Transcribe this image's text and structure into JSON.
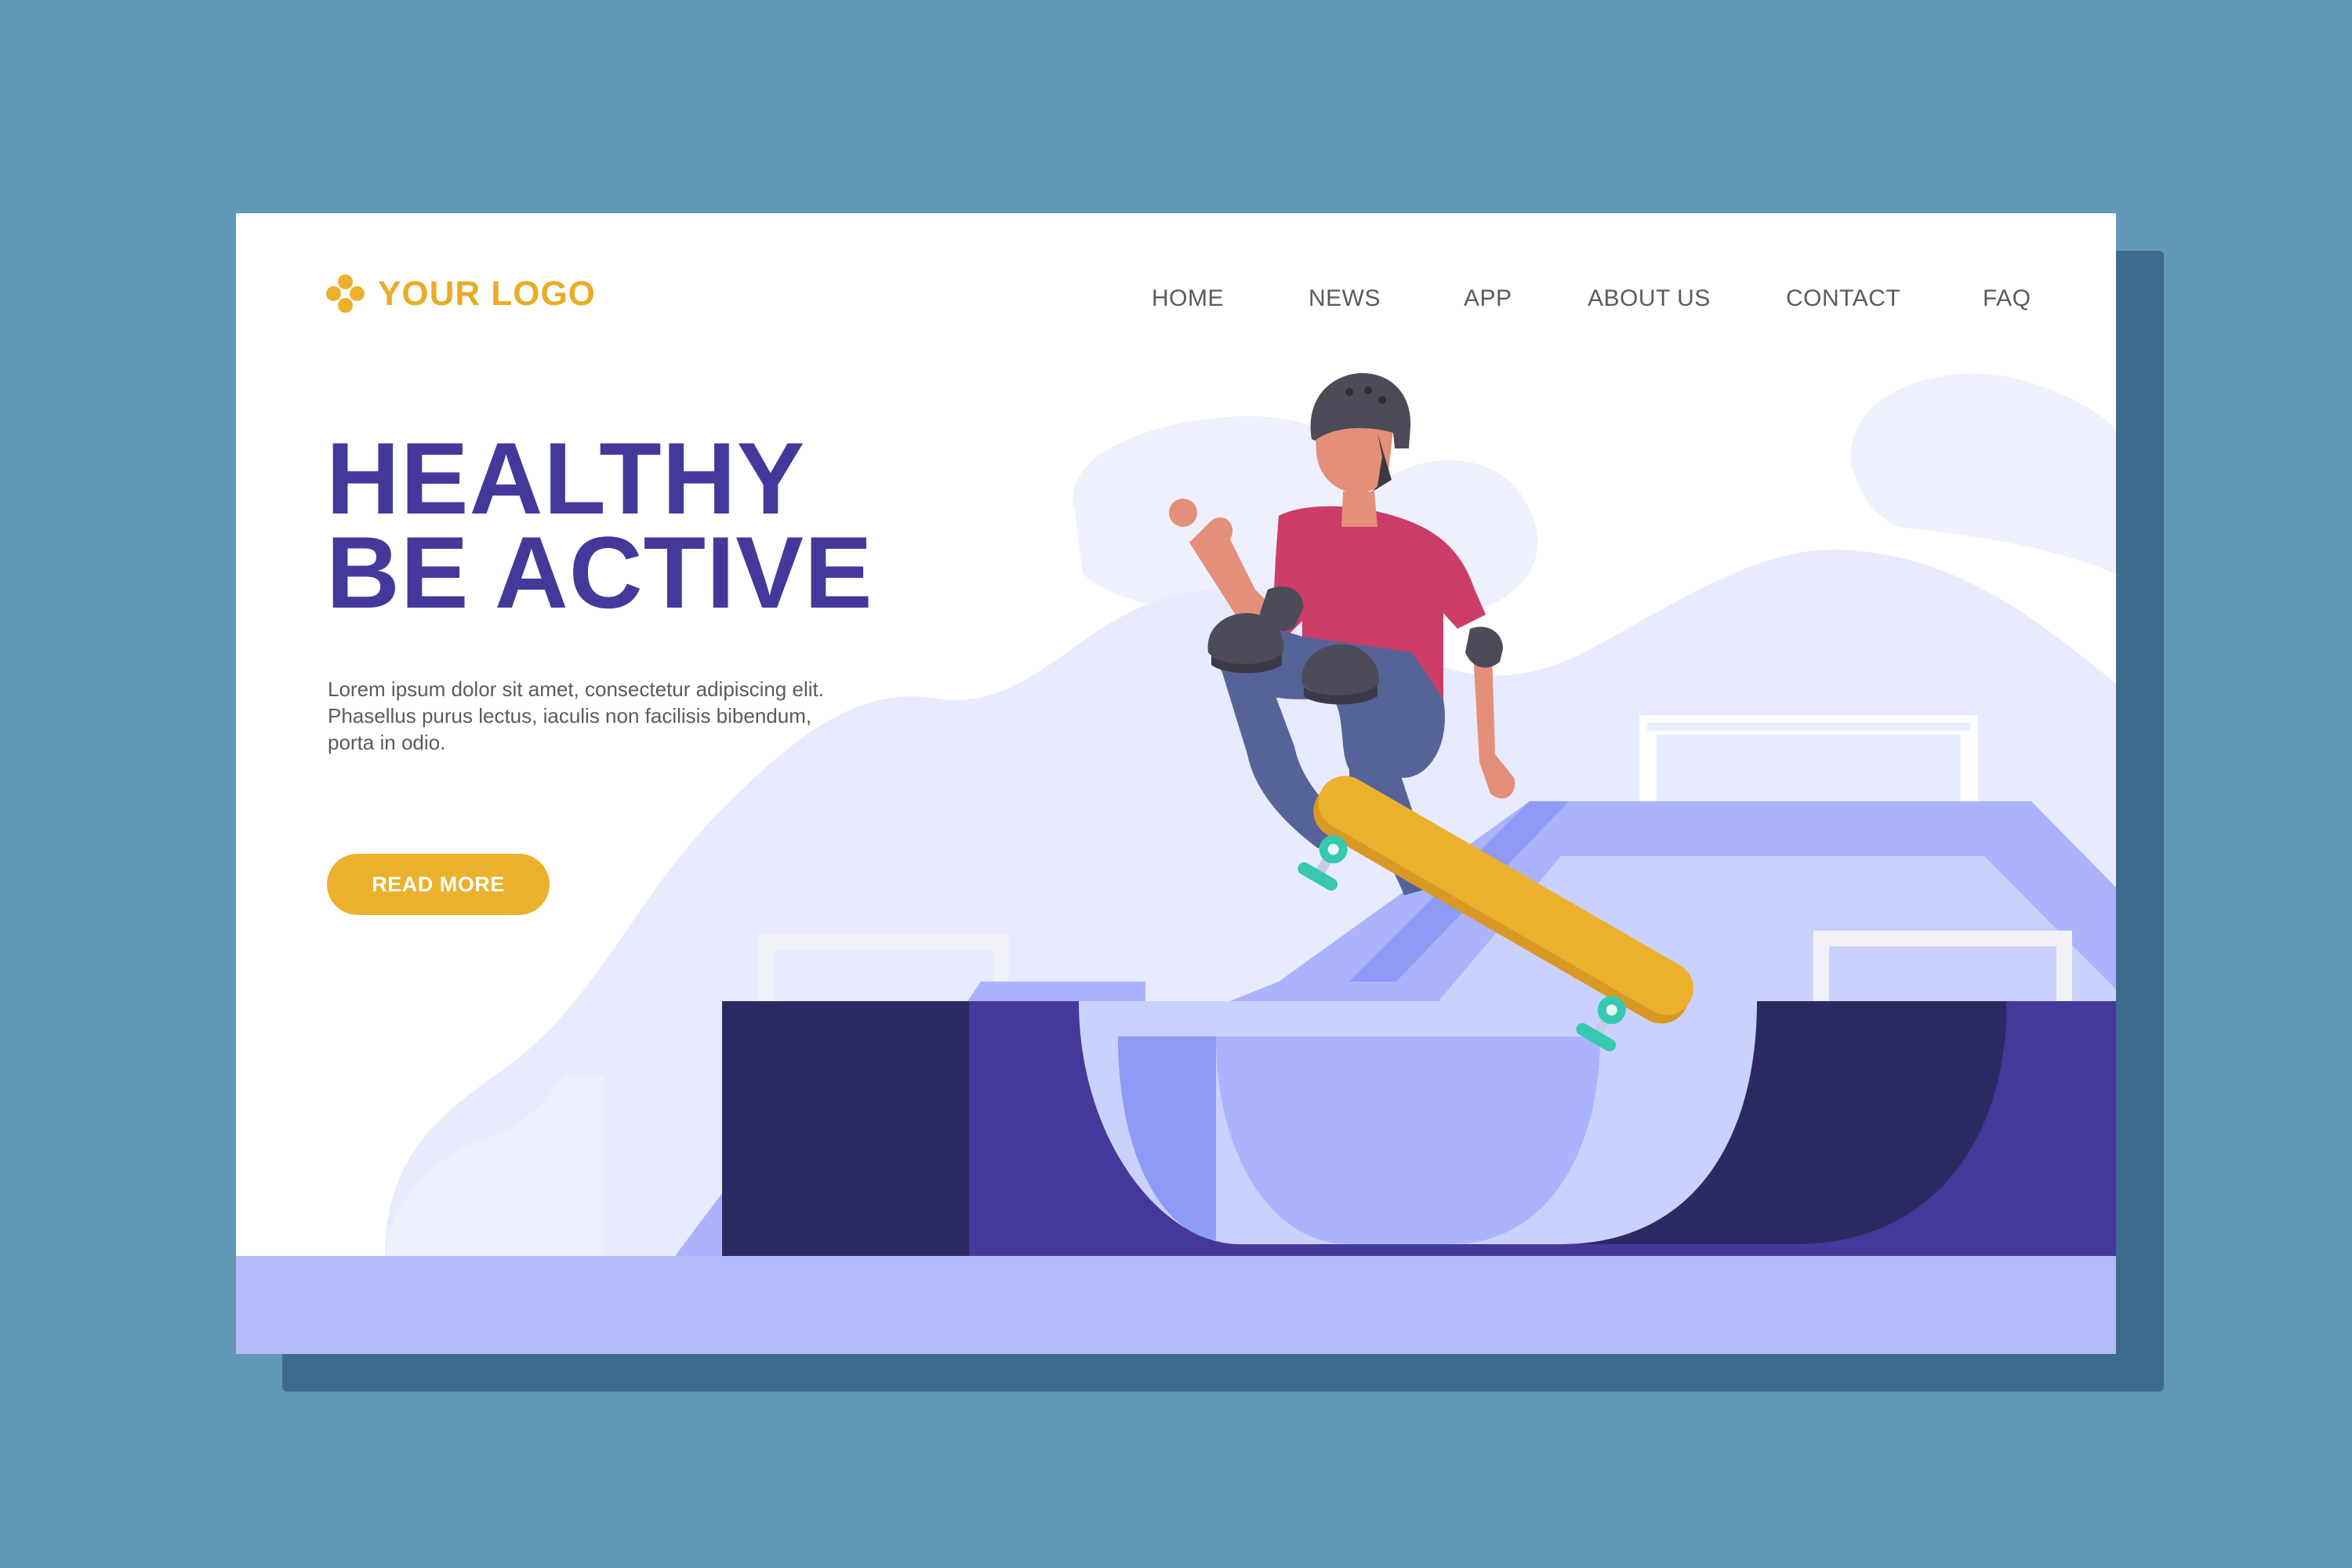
{
  "logo": {
    "text": "YOUR LOGO",
    "icon": "four-dot-flower-icon"
  },
  "nav": {
    "items": [
      {
        "label": "HOME"
      },
      {
        "label": "NEWS"
      },
      {
        "label": "APP"
      },
      {
        "label": "ABOUT US"
      },
      {
        "label": "CONTACT"
      },
      {
        "label": "FAQ"
      }
    ]
  },
  "hero": {
    "title_line1": "HEALTHY",
    "title_line2": "BE ACTIVE",
    "body_line1": "Lorem ipsum dolor sit amet, consectetur adipiscing elit.",
    "body_line2": "Phasellus purus lectus, iaculis non facilisis bibendum,",
    "body_line3": "porta in odio.",
    "cta_label": "READ MORE"
  },
  "illustration": {
    "subject": "skateboarder-jumping-over-half-pipe",
    "icons": [
      "skateboarder-icon",
      "skateboard-icon",
      "half-pipe-ramp-icon",
      "helmet-icon"
    ]
  },
  "colors": {
    "page_background": "#6098b6",
    "card": "#ffffff",
    "accent": "#ebb12c",
    "headline": "#44399b",
    "text": "#5b5b5b",
    "ramp_dark": "#2b2a63",
    "ramp_mid": "#44399b",
    "ramp_light": "#aab3fb",
    "cloud": "#e7ebfd",
    "shirt": "#cb3d67",
    "pants": "#556399",
    "skateboard": "#ebb12c",
    "wheels": "#36c9b0"
  }
}
